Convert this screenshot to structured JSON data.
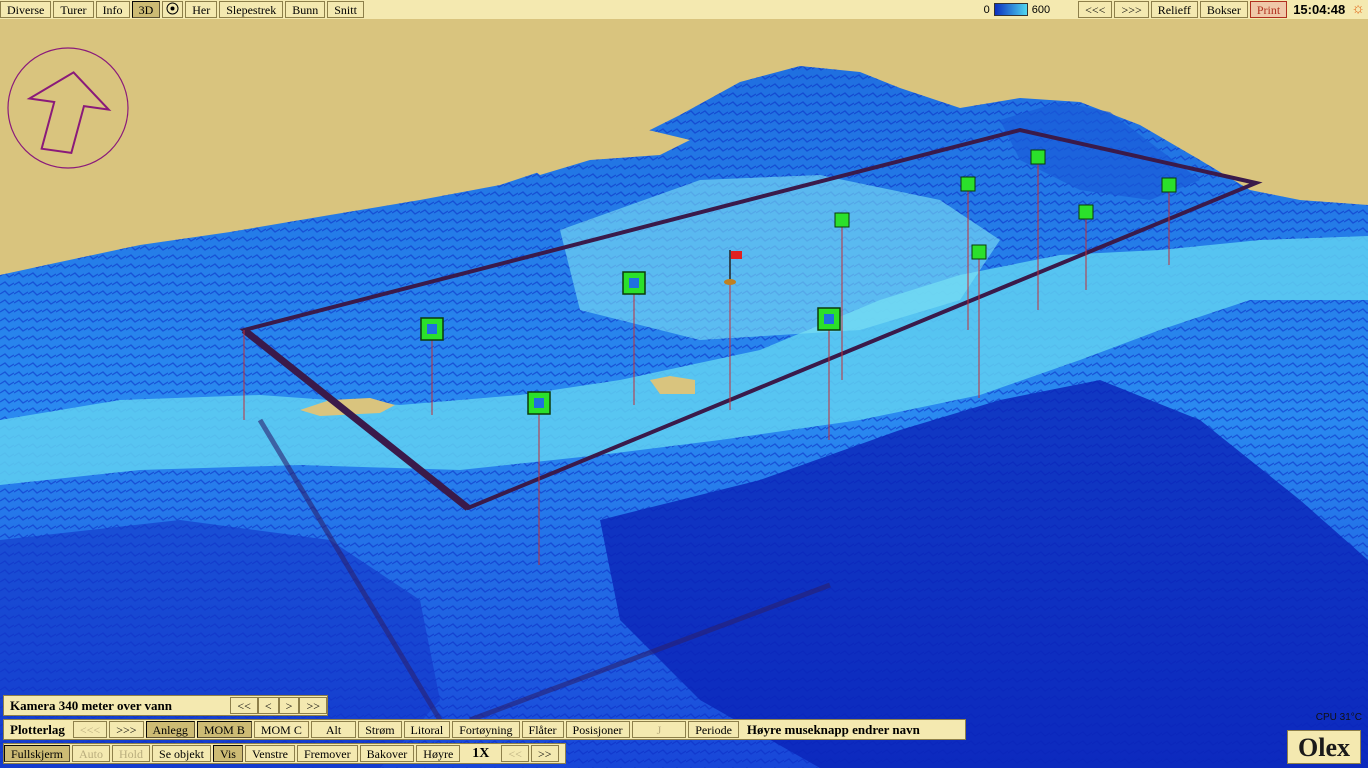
{
  "topbar": {
    "left": [
      "Diverse",
      "Turer",
      "Info",
      "3D",
      "Her",
      "Slepestrek",
      "Bunn",
      "Snitt"
    ],
    "scale_min": "0",
    "scale_max": "600",
    "right": [
      "<<<",
      ">>>",
      "Relieff",
      "Bokser"
    ],
    "print": "Print",
    "clock": "15:04:48"
  },
  "camera": {
    "label": "Kamera 340 meter over vann",
    "buttons": [
      "<<",
      "<",
      ">",
      ">>"
    ]
  },
  "plotter": {
    "label": "Plotterlag",
    "buttons": [
      "<<<",
      ">>>",
      "Anlegg",
      "MOM B",
      "MOM C",
      "Alt",
      "Strøm",
      "Litoral",
      "Fortøyning",
      "Flåter",
      "Posisjoner",
      "J",
      "Periode"
    ],
    "hint": "Høyre museknapp endrer navn"
  },
  "nav": {
    "buttons": [
      "Fullskjerm",
      "Auto",
      "Hold",
      "Se objekt",
      "Vis",
      "Venstre",
      "Fremover",
      "Bakover",
      "Høyre"
    ],
    "zoom": "1X",
    "zoom_buttons": [
      "<<",
      ">>"
    ]
  },
  "status": {
    "cpu": "CPU 31°C"
  },
  "logo": "Olex",
  "colors": {
    "land": "#d9c47e",
    "deep": "#0b2fbf",
    "shallow": "#4fd6f0",
    "marker": "#2be02b",
    "frame": "#3a1a4a",
    "pole": "#c0303a"
  },
  "icons": {
    "compass": "north-arrow-icon",
    "sun": "sun-icon",
    "target": "target-icon",
    "flag": "flag-icon"
  }
}
